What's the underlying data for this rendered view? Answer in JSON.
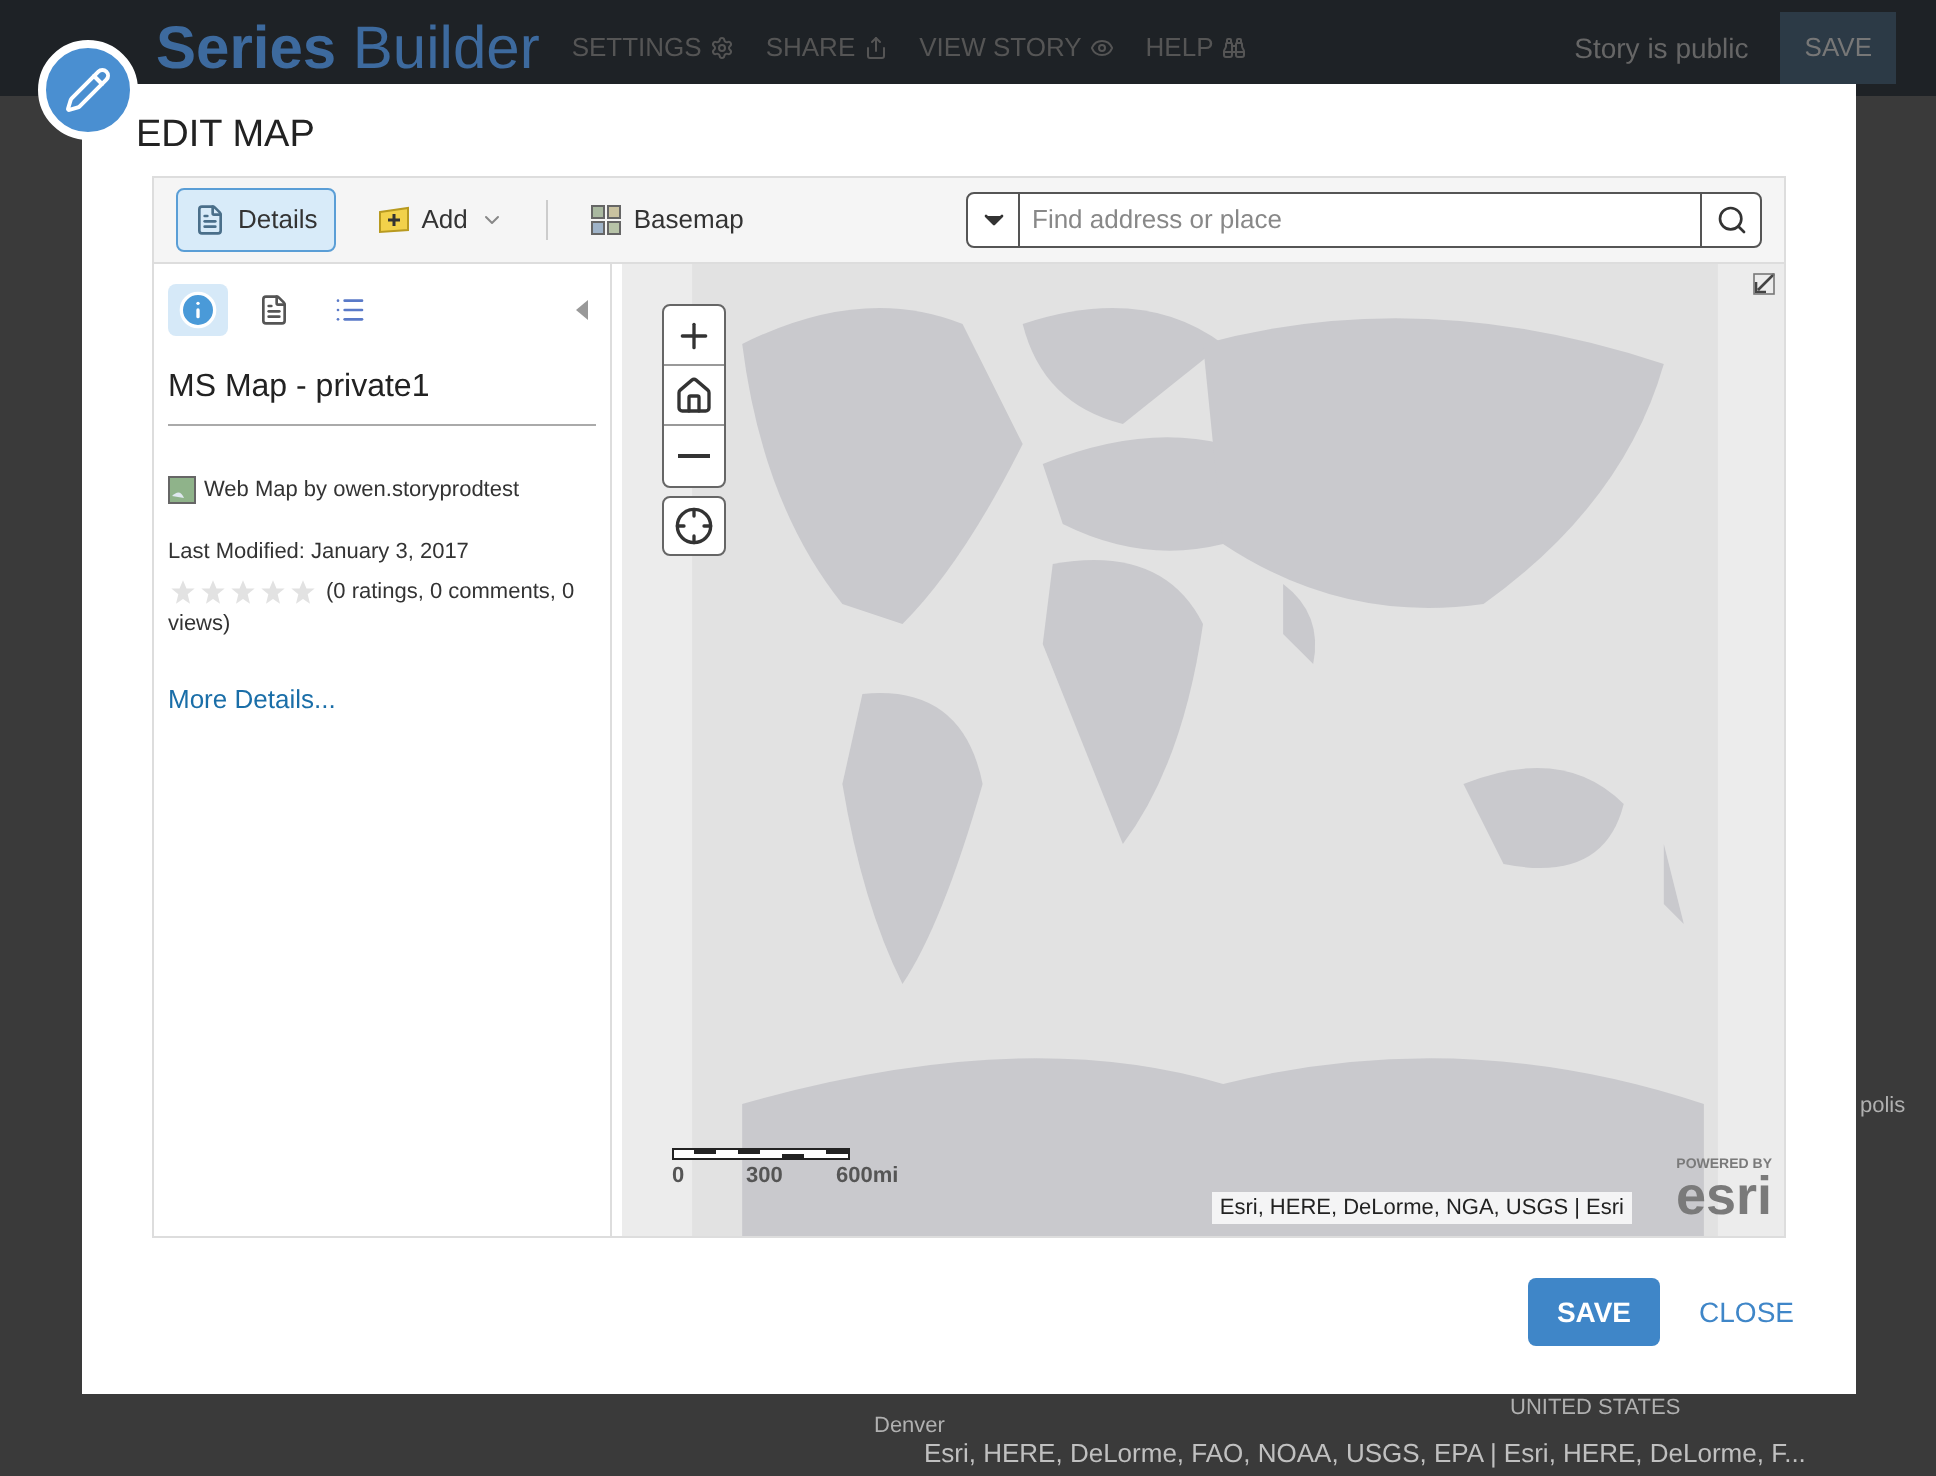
{
  "background": {
    "app_title_bold": "Series",
    "app_title": "Builder",
    "nav": [
      {
        "label": "SETTINGS"
      },
      {
        "label": "SHARE"
      },
      {
        "label": "VIEW STORY"
      },
      {
        "label": "HELP"
      }
    ],
    "story_status": "Story is public",
    "save_label": "SAVE",
    "map_labels": [
      "polis",
      "Denver",
      "UNITED STATES"
    ],
    "attribution": "Esri, HERE, DeLorme, FAO, NOAA, USGS, EPA | Esri, HERE, DeLorme, F..."
  },
  "dialog": {
    "title": "EDIT MAP",
    "toolbar": [
      {
        "kind": "details",
        "label": "Details",
        "selected": true
      },
      {
        "kind": "add",
        "label": "Add",
        "selected": false
      },
      {
        "kind": "basemap",
        "label": "Basemap",
        "selected": false
      }
    ],
    "search": {
      "placeholder": "Find address or place"
    },
    "side_tabs": [
      {
        "kind": "info",
        "selected": true
      },
      {
        "kind": "details",
        "selected": false
      },
      {
        "kind": "legend",
        "selected": false
      }
    ],
    "item": {
      "title": "MS Map - private1",
      "owner": "Web Map by owen.storyprodtest",
      "modified": "Last Modified: January 3, 2017",
      "stars": 0,
      "ratings": "(0 ratings, 0 comments, 0 views)",
      "link": "More Details..."
    },
    "map": {
      "scale_labels": [
        "0",
        "300",
        "600mi"
      ],
      "attribution": "Esri, HERE, DeLorme, NGA, USGS | Esri",
      "logo_top": "POWERED BY",
      "logo": "esri"
    },
    "buttons": [
      {
        "kind": "primary",
        "label": "SAVE"
      },
      {
        "kind": "link",
        "label": "CLOSE"
      }
    ]
  }
}
